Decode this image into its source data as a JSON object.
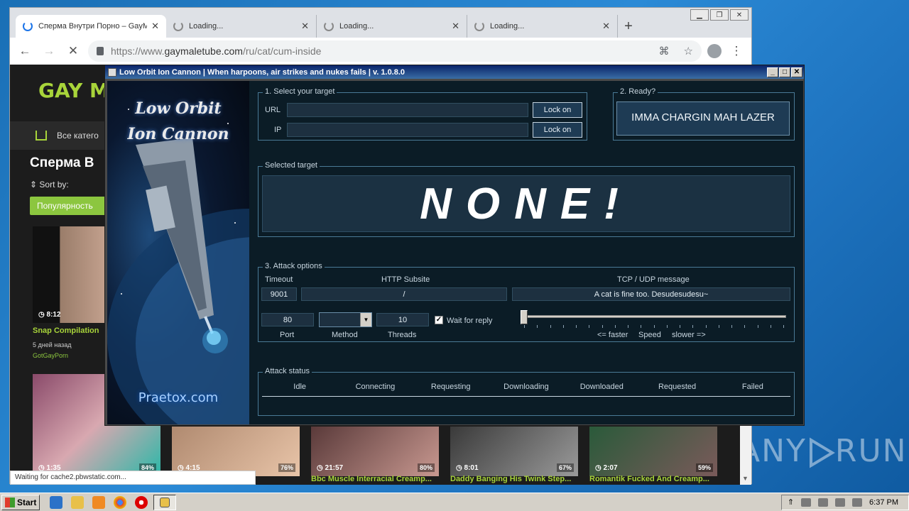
{
  "desktop": {
    "watermark": "ANY RUN"
  },
  "browser": {
    "tabs": [
      {
        "title": "Сперма Внутри Порно – GayM",
        "active": true
      },
      {
        "title": "Loading..."
      },
      {
        "title": "Loading..."
      },
      {
        "title": "Loading..."
      }
    ],
    "url_prefix": "https://www.",
    "url_host": "gaymaletube.com",
    "url_path": "/ru/cat/cum-inside",
    "status_text": "Waiting for cache2.pbwstatic.com...",
    "site": {
      "logo": "GAY M",
      "nav_label": "Все катего",
      "heading": "Сперма В",
      "sort_label": "Sort by:",
      "popular_btn": "Популярность",
      "videos": [
        {
          "duration": "8:12",
          "title": "Snap Compilation",
          "meta1": "5 дней назад",
          "meta2": "GotGayPorn"
        },
        {
          "duration": "1:35",
          "rating": "84%"
        },
        {
          "duration": "4:15",
          "rating": "76%"
        },
        {
          "duration": "21:57",
          "rating": "80%",
          "title": "Bbc Muscle Interracial Creamp..."
        },
        {
          "duration": "8:01",
          "rating": "67%",
          "title": "Daddy Banging His Twink Step..."
        },
        {
          "duration": "2:07",
          "rating": "59%",
          "title": "Romantik Fucked And Creamp..."
        }
      ]
    }
  },
  "loic": {
    "title": "Low Orbit Ion Cannon | When harpoons, air strikes and nukes fails | v. 1.0.8.0",
    "art_title_1": "Low Orbit",
    "art_title_2": "Ion Cannon",
    "art_footer": "Praetox.com",
    "select_target": {
      "legend": "1. Select your target",
      "url_label": "URL",
      "ip_label": "IP",
      "url_value": "",
      "ip_value": "",
      "lock_url": "Lock on",
      "lock_ip": "Lock on"
    },
    "ready": {
      "legend": "2. Ready?",
      "fire_button": "IMMA CHARGIN MAH LAZER"
    },
    "selected_target": {
      "legend": "Selected target",
      "value": "NONE!"
    },
    "attack_options": {
      "legend": "3. Attack options",
      "timeout_label": "Timeout",
      "timeout_value": "9001",
      "subsite_label": "HTTP Subsite",
      "subsite_value": "/",
      "message_label": "TCP / UDP message",
      "message_value": "A cat is fine too. Desudesudesu~",
      "port_value": "80",
      "port_label": "Port",
      "method_value": "",
      "method_label": "Method",
      "threads_value": "10",
      "threads_label": "Threads",
      "wait_reply_label": "Wait for reply",
      "wait_reply_checked": true,
      "speed_faster": "<= faster",
      "speed_label": "Speed",
      "speed_slower": "slower =>",
      "speed_fraction": 0.0
    },
    "attack_status": {
      "legend": "Attack status",
      "columns": [
        "Idle",
        "Connecting",
        "Requesting",
        "Downloading",
        "Downloaded",
        "Requested",
        "Failed"
      ]
    }
  },
  "taskbar": {
    "start": "Start",
    "clock": "6:37 PM"
  }
}
